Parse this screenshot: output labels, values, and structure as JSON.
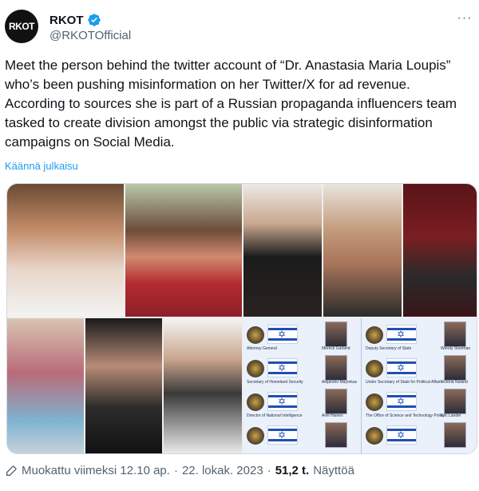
{
  "author": {
    "avatar_text": "RKOT",
    "display_name": "RKOT",
    "handle": "@RKOTOfficial",
    "verified_color": "#1d9bf0"
  },
  "tweet": {
    "text": "Meet the person behind the twitter account of “Dr. Anastasia Maria Loupis” who’s been pushing misinformation on her Twitter/X for ad revenue. According to sources she is part of a Russian propaganda influencers team tasked to create division amongst the public via strategic disinformation campaigns on Social Media.",
    "translate_label": "Käännä julkaisu"
  },
  "media": {
    "org_chart": {
      "left": [
        {
          "title": "Attorney General",
          "name": "Merrick Garland"
        },
        {
          "title": "Secretary of Homeland Security",
          "name": "Alejandro Mayorkas"
        },
        {
          "title": "Director of National Intelligence",
          "name": "Avril Haines"
        },
        {
          "title": "",
          "name": ""
        }
      ],
      "right": [
        {
          "title": "Deputy Secretary of State",
          "name": "Wendy Sherman"
        },
        {
          "title": "Under Secretary of State for Political Affairs",
          "name": "Victoria Nuland"
        },
        {
          "title": "The Office of Science and Technology Policy",
          "name": "Eric Lander"
        },
        {
          "title": "",
          "name": ""
        }
      ]
    }
  },
  "footer": {
    "edited_label": "Muokattu viimeksi 12.10 ap.",
    "separator1": "·",
    "date": "22. lokak. 2023",
    "separator2": "·",
    "views_count": "51,2 t.",
    "views_label": "Näyttöä"
  },
  "colors": {
    "text": "#0f1419",
    "secondary": "#536471",
    "link": "#1d9bf0"
  }
}
